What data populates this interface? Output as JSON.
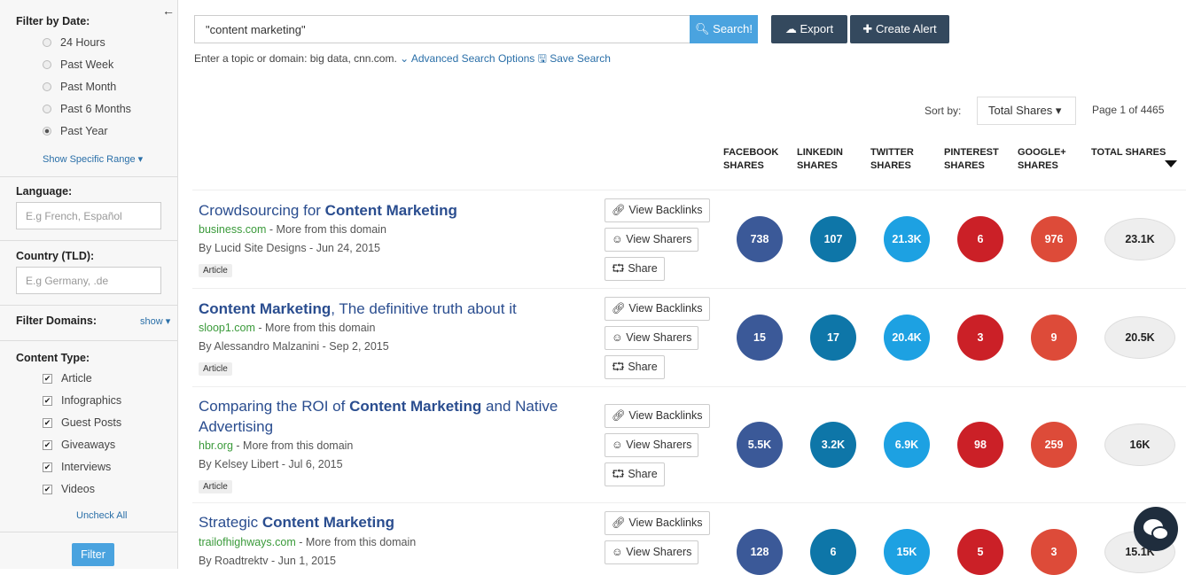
{
  "sidebar": {
    "filter_date_title": "Filter by Date:",
    "date_options": [
      {
        "label": "24 Hours",
        "selected": false
      },
      {
        "label": "Past Week",
        "selected": false
      },
      {
        "label": "Past Month",
        "selected": false
      },
      {
        "label": "Past 6 Months",
        "selected": false
      },
      {
        "label": "Past Year",
        "selected": true
      }
    ],
    "show_range": "Show Specific Range",
    "language_title": "Language:",
    "language_placeholder": "E.g French, Español",
    "country_title": "Country (TLD):",
    "country_placeholder": "E.g Germany, .de",
    "filter_domains_title": "Filter Domains:",
    "filter_domains_show": "show",
    "content_type_title": "Content Type:",
    "content_types": [
      "Article",
      "Infographics",
      "Guest Posts",
      "Giveaways",
      "Interviews",
      "Videos"
    ],
    "uncheck_all": "Uncheck All",
    "filter_button": "Filter"
  },
  "search": {
    "query": "\"content marketing\"",
    "search_button": "Search!",
    "export_button": "Export",
    "create_alert_button": "Create Alert",
    "hint_text": "Enter a topic or domain: big data, cnn.com.",
    "advanced_link": "Advanced Search Options",
    "save_link": "Save Search"
  },
  "results_header": {
    "sort_label": "Sort by:",
    "sort_value": "Total Shares",
    "page_info": "Page 1 of 4465",
    "columns": [
      {
        "line1": "FACEBOOK",
        "line2": "SHARES"
      },
      {
        "line1": "LINKEDIN",
        "line2": "SHARES"
      },
      {
        "line1": "TWITTER",
        "line2": "SHARES"
      },
      {
        "line1": "PINTEREST",
        "line2": "SHARES"
      },
      {
        "line1": "GOOGLE+",
        "line2": "SHARES"
      },
      {
        "line1": "TOTAL SHARES",
        "line2": ""
      }
    ]
  },
  "actions": {
    "backlinks": "View Backlinks",
    "sharers": "View Sharers",
    "share": "Share"
  },
  "colors": {
    "facebook": "#3b5998",
    "linkedin": "#0e76a8",
    "twitter": "#1da1e2",
    "pinterest": "#cb2027",
    "google": "#dd4b39"
  },
  "results": [
    {
      "title_pre": "Crowdsourcing for ",
      "title_bold": "Content Marketing",
      "title_post": "",
      "domain": "business.com",
      "more": " - More from this domain",
      "author": "By Lucid Site Designs - Jun 24, 2015",
      "tag": "Article",
      "facebook": "738",
      "linkedin": "107",
      "twitter": "21.3K",
      "pinterest": "6",
      "google": "976",
      "total": "23.1K"
    },
    {
      "title_pre": "",
      "title_bold": "Content Marketing",
      "title_post": ", The definitive truth about it",
      "domain": "sloop1.com",
      "more": " - More from this domain",
      "author": "By Alessandro Malzanini - Sep 2, 2015",
      "tag": "Article",
      "facebook": "15",
      "linkedin": "17",
      "twitter": "20.4K",
      "pinterest": "3",
      "google": "9",
      "total": "20.5K"
    },
    {
      "title_pre": "Comparing the ROI of ",
      "title_bold": "Content Marketing",
      "title_post": " and Native Advertising",
      "domain": "hbr.org",
      "more": " - More from this domain",
      "author": "By Kelsey Libert - Jul 6, 2015",
      "tag": "Article",
      "facebook": "5.5K",
      "linkedin": "3.2K",
      "twitter": "6.9K",
      "pinterest": "98",
      "google": "259",
      "total": "16K"
    },
    {
      "title_pre": "Strategic ",
      "title_bold": "Content Marketing",
      "title_post": "",
      "domain": "trailofhighways.com",
      "more": " - More from this domain",
      "author": "By Roadtrektv - Jun 1, 2015",
      "tag": "",
      "facebook": "128",
      "linkedin": "6",
      "twitter": "15K",
      "pinterest": "5",
      "google": "3",
      "total": "15.1K"
    }
  ]
}
